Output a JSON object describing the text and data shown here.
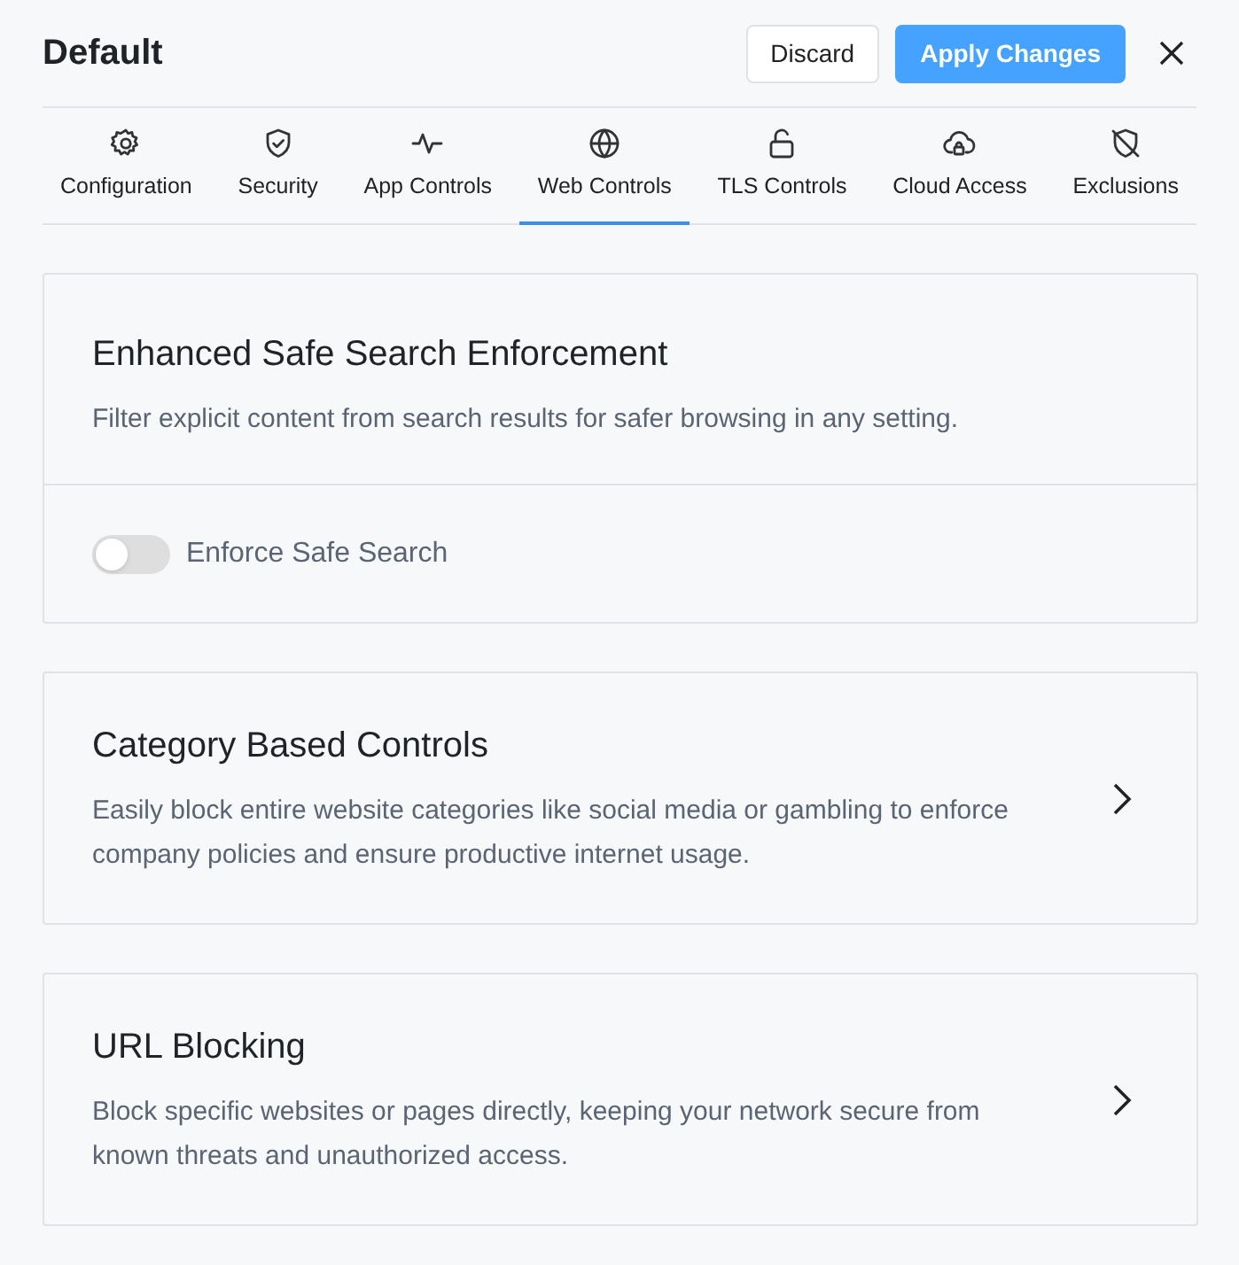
{
  "header": {
    "title": "Default",
    "buttons": [
      {
        "label": "Discard",
        "kind": "secondary"
      },
      {
        "label": "Apply Changes",
        "kind": "primary"
      }
    ]
  },
  "tabs": [
    {
      "label": "Configuration",
      "selected": false
    },
    {
      "label": "Security",
      "selected": false
    },
    {
      "label": "App Controls",
      "selected": false
    },
    {
      "label": "Web Controls",
      "selected": true
    },
    {
      "label": "TLS Controls",
      "selected": false
    },
    {
      "label": "Cloud Access",
      "selected": false
    },
    {
      "label": "Exclusions",
      "selected": false
    }
  ],
  "sections": [
    {
      "kind": "toggle",
      "title": "Enhanced Safe Search Enforcement",
      "description": "Filter explicit content from search results for safer browsing in any setting.",
      "toggle": {
        "label": "Enforce Safe Search",
        "on": false
      }
    },
    {
      "kind": "link",
      "title": "Category Based Controls",
      "description": "Easily block entire website categories like social media or gambling to enforce company policies and ensure productive internet usage."
    },
    {
      "kind": "link",
      "title": "URL Blocking",
      "description": "Block specific websites or pages directly, keeping your network secure from known threats and unauthorized access."
    }
  ]
}
